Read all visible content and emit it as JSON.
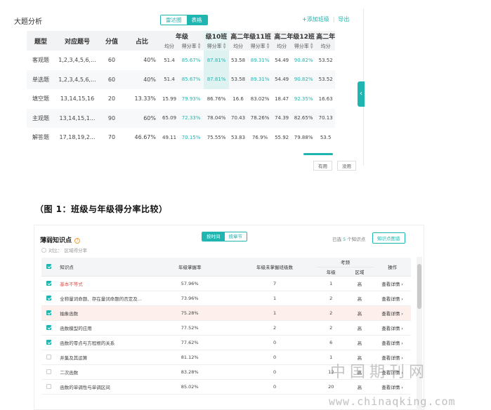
{
  "panel1": {
    "title": "大题分析",
    "view_toggle": [
      "雷达图",
      "表格"
    ],
    "links": {
      "add_class": "+添加班级",
      "sep": "|",
      "export": "导出"
    },
    "headers": [
      "题型",
      "对应题号",
      "分值",
      "占比"
    ],
    "groups": [
      "年级",
      "级10班",
      "高二年级11班",
      "高二年级12班",
      "高二年"
    ],
    "sub_headers": [
      "均分",
      "得分率"
    ],
    "rows": [
      {
        "type": "客观题",
        "nums": "1,2,3,4,5,6,...",
        "score": "60",
        "pct": "40%",
        "vals": [
          "51.4",
          "85.67%",
          "87.81%",
          "53.58",
          "89.31%",
          "54.49",
          "90.82%",
          "53.52"
        ]
      },
      {
        "type": "单选题",
        "nums": "1,2,3,4,5,6,...",
        "score": "60",
        "pct": "40%",
        "vals": [
          "51.4",
          "85.67%",
          "87.81%",
          "53.58",
          "89.31%",
          "54.49",
          "90.82%",
          "53.52"
        ]
      },
      {
        "type": "填空题",
        "nums": "13,14,15,16",
        "score": "20",
        "pct": "13.33%",
        "vals": [
          "15.99",
          "79.93%",
          "86.76%",
          "16.6",
          "83.02%",
          "18.47",
          "92.35%",
          "16.63"
        ]
      },
      {
        "type": "主观题",
        "nums": "13,14,15,1...",
        "score": "90",
        "pct": "60%",
        "vals": [
          "65.09",
          "72.33%",
          "78.04%",
          "70.43",
          "78.26%",
          "74.39",
          "82.65%",
          "70.13"
        ]
      },
      {
        "type": "解答题",
        "nums": "17,18,19,2...",
        "score": "70",
        "pct": "46.67%",
        "vals": [
          "49.11",
          "70.15%",
          "75.55%",
          "53.83",
          "76.9%",
          "55.92",
          "79.88%",
          "53.5"
        ]
      }
    ],
    "vote": {
      "useful": "有用",
      "useless": "没用"
    },
    "side_arrow": "‹"
  },
  "caption": "（图 1：班级与年级得分率比较）",
  "panel2": {
    "title": "薄弱知识点",
    "help": "?",
    "compare_label": "对比：",
    "compare_option": "区域得分率",
    "tabs": [
      "按时间",
      "按章节"
    ],
    "selected_prefix": "已选",
    "selected_count": "5",
    "selected_suffix": "个知识点",
    "graph_button": "知识点图谱",
    "headers": {
      "point": "知识点",
      "grade_rate": "年级掌握率",
      "unmastered": "年级未掌握班级数",
      "freq": "考频",
      "freq_grade": "年级",
      "freq_region": "区域",
      "action": "操作"
    },
    "rows": [
      {
        "checked": true,
        "name": "基本不等式",
        "rate": "57.96%",
        "count": "7",
        "grade": "1",
        "region": "高",
        "action": "查看详情",
        "red": true
      },
      {
        "checked": true,
        "name": "全称量词命题、存在量词命题的否定及...",
        "rate": "73.96%",
        "count": "1",
        "grade": "2",
        "region": "高",
        "action": "查看详情"
      },
      {
        "checked": true,
        "name": "抽象函数",
        "rate": "75.28%",
        "count": "1",
        "grade": "2",
        "region": "高",
        "action": "查看详情",
        "highlight": true
      },
      {
        "checked": true,
        "name": "函数模型的应用",
        "rate": "77.52%",
        "count": "2",
        "grade": "2",
        "region": "高",
        "action": "查看详情"
      },
      {
        "checked": true,
        "name": "函数的零点与方程根的关系",
        "rate": "77.62%",
        "count": "0",
        "grade": "6",
        "region": "高",
        "action": "查看详情"
      },
      {
        "checked": false,
        "name": "并集及其运算",
        "rate": "81.12%",
        "count": "0",
        "grade": "1",
        "region": "高",
        "action": "查看详情"
      },
      {
        "checked": false,
        "name": "二次函数",
        "rate": "83.28%",
        "count": "0",
        "grade": "12",
        "region": "高",
        "action": "查看详情"
      },
      {
        "checked": false,
        "name": "函数的单调性与单调区间",
        "rate": "85.02%",
        "count": "0",
        "grade": "20",
        "region": "高",
        "action": "查看详情"
      }
    ]
  },
  "watermark": {
    "cn": "中国期刊网",
    "url": "www.chinaqking.com"
  },
  "colors": {
    "accent": "#1fb5b0",
    "danger": "#e0524f",
    "highlight_row": "#fdf0ec"
  }
}
